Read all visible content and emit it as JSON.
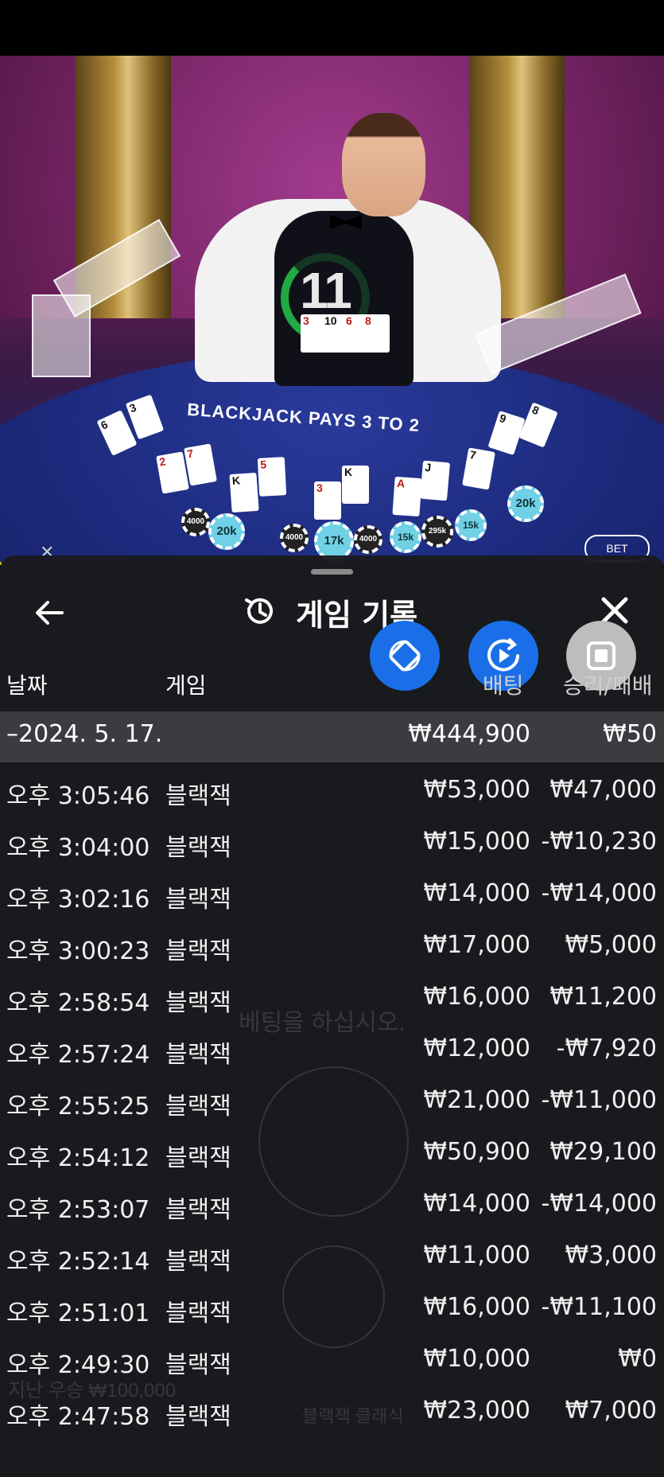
{
  "video": {
    "timer": "11",
    "felt_text": "BLACKJACK PAYS 3 TO 2",
    "bet_behind": "BET"
  },
  "sheet": {
    "title": "게임 기록",
    "columns": {
      "date": "날짜",
      "game": "게임",
      "bet": "배팅",
      "win_loss": "승리/패배"
    },
    "day": {
      "label": "–2024. 5. 17.",
      "bet_total": "₩444,900",
      "win_total": "₩50"
    },
    "rows": [
      {
        "time": "오후 3:05:46",
        "game": "블랙잭",
        "bet": "₩53,000",
        "result": "₩47,000"
      },
      {
        "time": "오후 3:04:00",
        "game": "블랙잭",
        "bet": "₩15,000",
        "result": "-₩10,230"
      },
      {
        "time": "오후 3:02:16",
        "game": "블랙잭",
        "bet": "₩14,000",
        "result": "-₩14,000"
      },
      {
        "time": "오후 3:00:23",
        "game": "블랙잭",
        "bet": "₩17,000",
        "result": "₩5,000"
      },
      {
        "time": "오후 2:58:54",
        "game": "블랙잭",
        "bet": "₩16,000",
        "result": "₩11,200"
      },
      {
        "time": "오후 2:57:24",
        "game": "블랙잭",
        "bet": "₩12,000",
        "result": "-₩7,920"
      },
      {
        "time": "오후 2:55:25",
        "game": "블랙잭",
        "bet": "₩21,000",
        "result": "-₩11,000"
      },
      {
        "time": "오후 2:54:12",
        "game": "블랙잭",
        "bet": "₩50,900",
        "result": "₩29,100"
      },
      {
        "time": "오후 2:53:07",
        "game": "블랙잭",
        "bet": "₩14,000",
        "result": "-₩14,000"
      },
      {
        "time": "오후 2:52:14",
        "game": "블랙잭",
        "bet": "₩11,000",
        "result": "₩3,000"
      },
      {
        "time": "오후 2:51:01",
        "game": "블랙잭",
        "bet": "₩16,000",
        "result": "-₩11,100"
      },
      {
        "time": "오후 2:49:30",
        "game": "블랙잭",
        "bet": "₩10,000",
        "result": "₩0"
      },
      {
        "time": "오후 2:47:58",
        "game": "블랙잭",
        "bet": "₩23,000",
        "result": "₩7,000"
      }
    ]
  },
  "background_game": {
    "prompt": "베팅을 하십시오.",
    "last_win": "지난 우승 ₩100,000",
    "footer_game": "블랙잭 클래식"
  },
  "icons": {
    "back": "back-arrow-icon",
    "history": "history-icon",
    "close": "close-icon",
    "rotate": "rotate-screen-icon",
    "video": "video-play-icon",
    "stop": "stop-icon"
  }
}
